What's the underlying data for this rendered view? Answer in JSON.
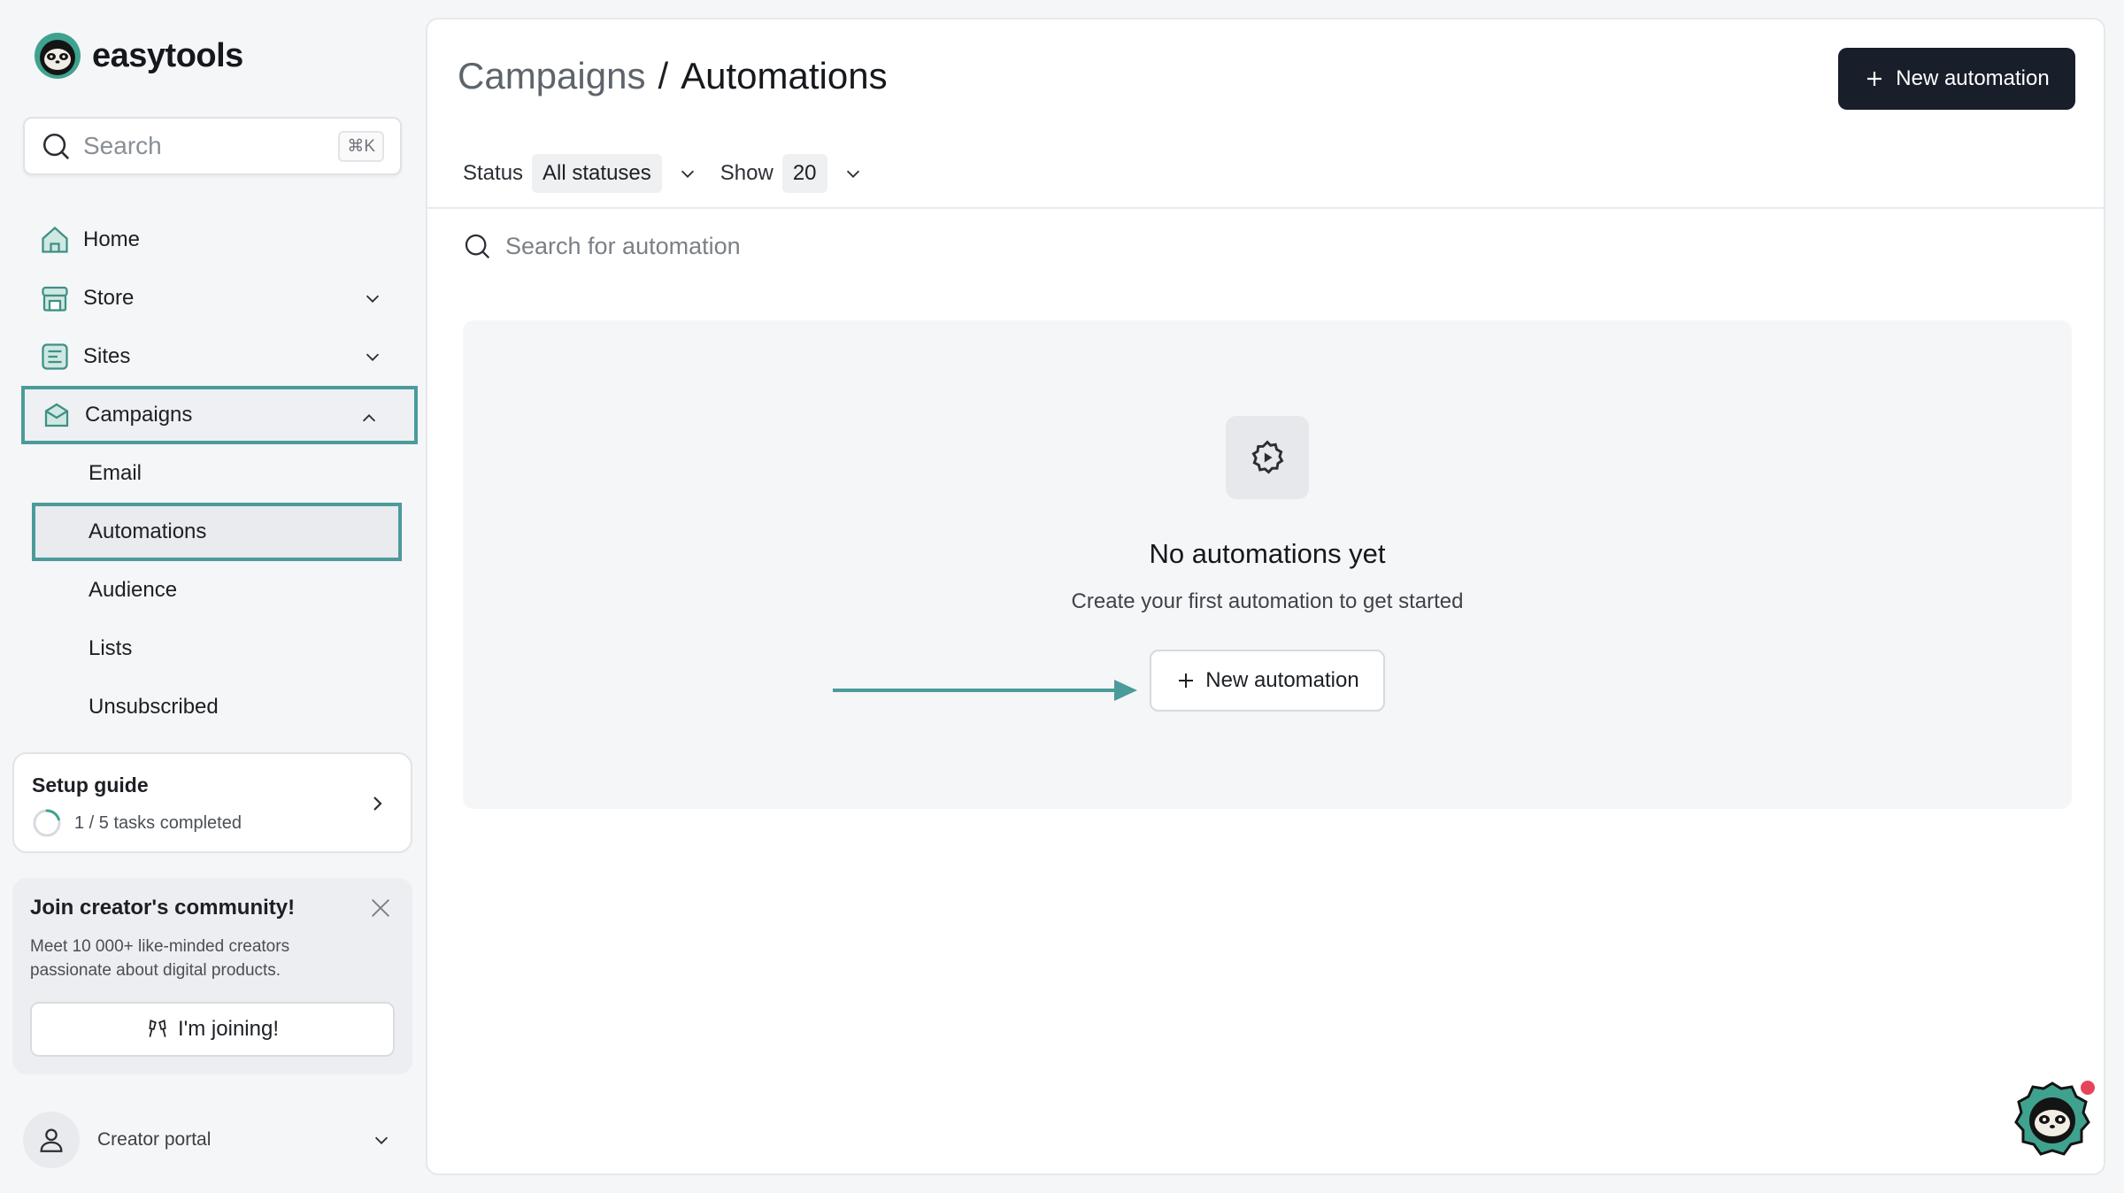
{
  "brand": {
    "name": "easytools",
    "accent": "#4b9b9b"
  },
  "search": {
    "placeholder": "Search",
    "shortcut": "⌘K"
  },
  "nav": {
    "items": [
      {
        "label": "Home",
        "icon": "home-icon"
      },
      {
        "label": "Store",
        "icon": "store-icon"
      },
      {
        "label": "Sites",
        "icon": "sites-icon"
      },
      {
        "label": "Campaigns",
        "icon": "campaigns-icon"
      }
    ],
    "campaigns_sub": [
      "Email",
      "Automations",
      "Audience",
      "Lists",
      "Unsubscribed"
    ]
  },
  "setup": {
    "title": "Setup guide",
    "progress": "1 / 5 tasks completed",
    "completed": 1,
    "total": 5
  },
  "community": {
    "title": "Join creator's community!",
    "description": "Meet 10 000+ like-minded creators passionate about digital products.",
    "button": "I'm joining!"
  },
  "portal": {
    "label": "Creator portal"
  },
  "header": {
    "crumb_parent": "Campaigns",
    "separator": "/",
    "crumb_current": "Automations",
    "new_button": "New automation"
  },
  "filters": {
    "status_label": "Status",
    "status_value": "All statuses",
    "show_label": "Show",
    "show_value": "20"
  },
  "automation_search": {
    "placeholder": "Search for automation"
  },
  "empty_state": {
    "title": "No automations yet",
    "subtitle": "Create your first automation to get started",
    "button": "New automation"
  }
}
